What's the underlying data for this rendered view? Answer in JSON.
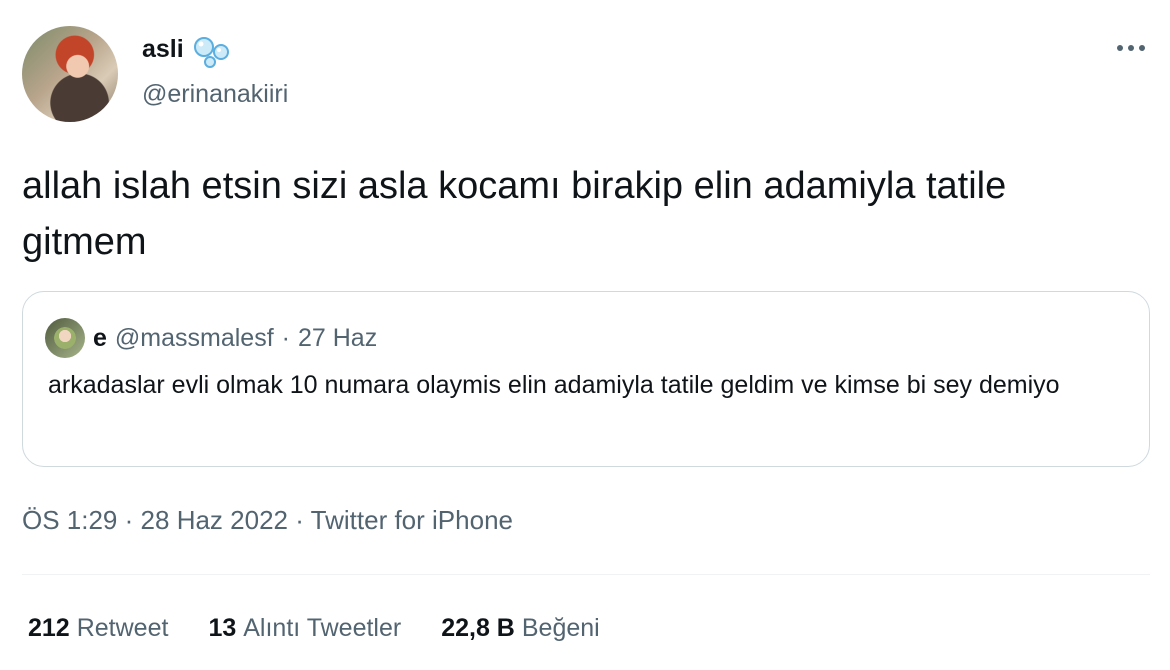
{
  "author": {
    "name": "asli",
    "handle": "@erinanakiiri",
    "avatar_icon": "avatar-photo",
    "name_emoji": "bubbles-icon"
  },
  "tweet": {
    "text": "allah islah etsin sizi asla kocamı birakip elin adamiyla tatile gitmem"
  },
  "quoted_tweet": {
    "name": "e",
    "handle": "@massmalesf",
    "separator": "·",
    "date": "27 Haz",
    "text": "arkadaslar evli olmak 10 numara olaymis elin adamiyla tatile geldim ve kimse bi sey demiyo"
  },
  "meta": {
    "time": "ÖS 1:29",
    "separator": "·",
    "date": "28 Haz 2022",
    "source": "Twitter for iPhone"
  },
  "stats": {
    "retweets_count": "212",
    "retweets_label": "Retweet",
    "quotes_count": "13",
    "quotes_label": "Alıntı Tweetler",
    "likes_count": "22,8 B",
    "likes_label": "Beğeni"
  },
  "colors": {
    "text_primary": "#0f1419",
    "text_secondary": "#536471",
    "border": "#cfd9de",
    "bubble": "#7ec8f0"
  }
}
